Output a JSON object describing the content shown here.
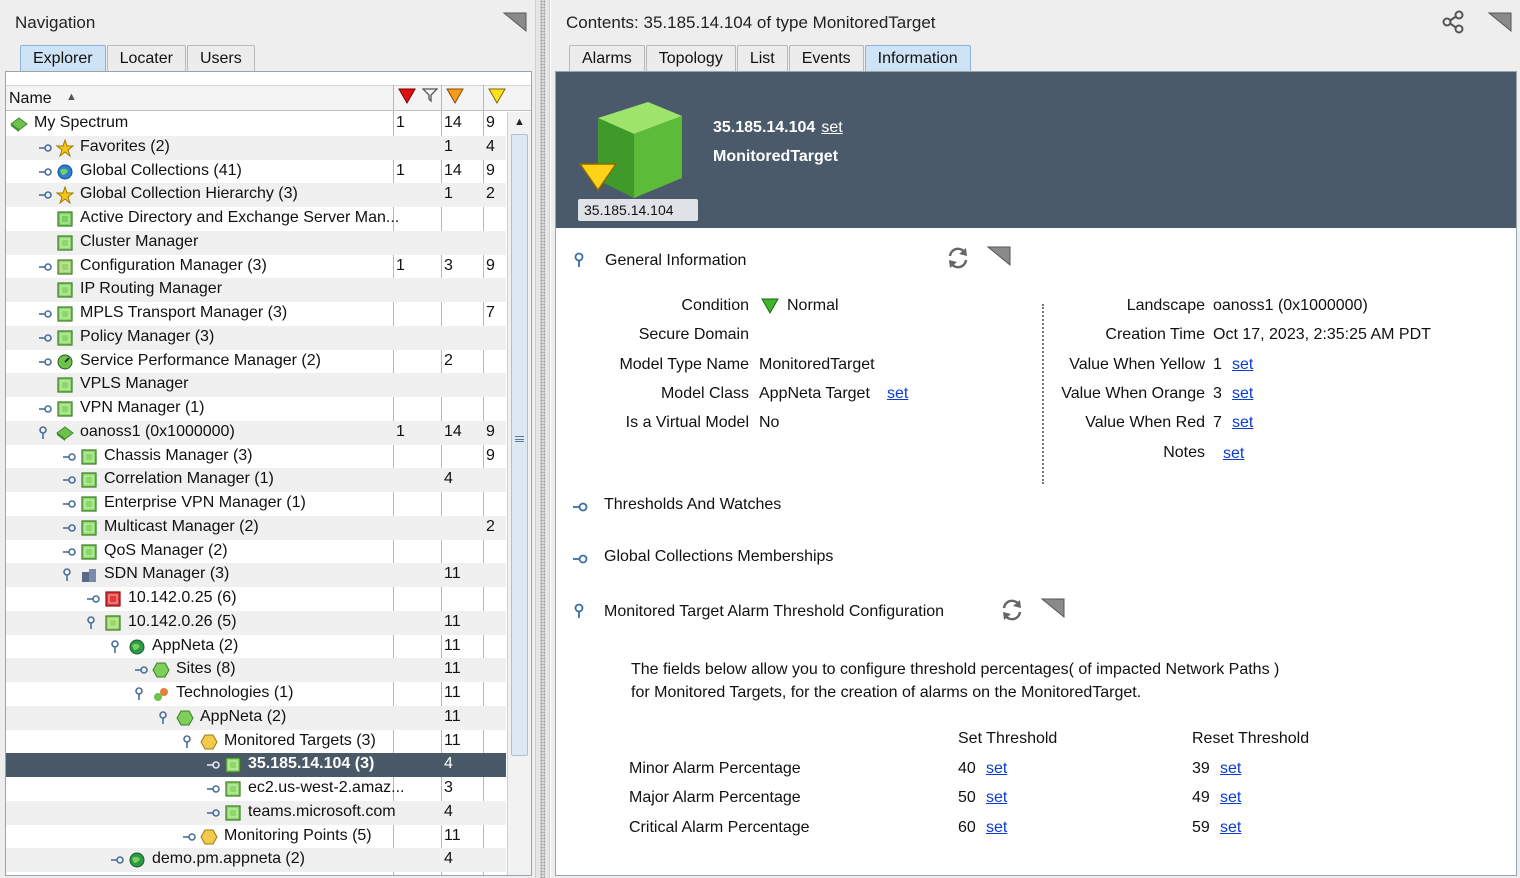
{
  "navigation": {
    "title": "Navigation",
    "tabs": [
      "Explorer",
      "Locater",
      "Users"
    ],
    "active_tab": "Explorer",
    "column_header": "Name",
    "rows": [
      {
        "name": "My Spectrum",
        "c1": "1",
        "c2": "14",
        "c3": "9",
        "icon": "my-spectrum-icon"
      },
      {
        "name": "Favorites  (2)",
        "c1": "",
        "c2": "1",
        "c3": "4",
        "icon": "star-icon"
      },
      {
        "name": "Global Collections  (41)",
        "c1": "1",
        "c2": "14",
        "c3": "9",
        "icon": "globe-icon"
      },
      {
        "name": "Global Collection Hierarchy  (3)",
        "c1": "",
        "c2": "1",
        "c3": "2",
        "icon": "star-icon"
      },
      {
        "name": "Active Directory and Exchange Server Man...",
        "c1": "",
        "c2": "",
        "c3": "",
        "icon": "directory-icon"
      },
      {
        "name": "Cluster Manager",
        "c1": "",
        "c2": "",
        "c3": "",
        "icon": "manager-icon"
      },
      {
        "name": "Configuration Manager  (3)",
        "c1": "1",
        "c2": "3",
        "c3": "9",
        "icon": "config-icon"
      },
      {
        "name": "IP Routing Manager",
        "c1": "",
        "c2": "",
        "c3": "",
        "icon": "manager-icon"
      },
      {
        "name": "MPLS Transport Manager  (3)",
        "c1": "",
        "c2": "",
        "c3": "7",
        "icon": "manager-icon"
      },
      {
        "name": "Policy Manager  (3)",
        "c1": "",
        "c2": "",
        "c3": "",
        "icon": "manager-icon"
      },
      {
        "name": "Service Performance Manager  (2)",
        "c1": "",
        "c2": "2",
        "c3": "",
        "icon": "gauge-icon"
      },
      {
        "name": "VPLS Manager",
        "c1": "",
        "c2": "",
        "c3": "",
        "icon": "manager-icon"
      },
      {
        "name": "VPN Manager  (1)",
        "c1": "",
        "c2": "",
        "c3": "",
        "icon": "manager-icon"
      },
      {
        "name": "oanoss1 (0x1000000)",
        "c1": "1",
        "c2": "14",
        "c3": "9",
        "icon": "landscape-icon"
      },
      {
        "name": "Chassis Manager  (3)",
        "c1": "",
        "c2": "",
        "c3": "9",
        "icon": "manager-icon"
      },
      {
        "name": "Correlation Manager  (1)",
        "c1": "",
        "c2": "4",
        "c3": "",
        "icon": "manager-icon"
      },
      {
        "name": "Enterprise VPN Manager  (1)",
        "c1": "",
        "c2": "",
        "c3": "",
        "icon": "manager-icon"
      },
      {
        "name": "Multicast Manager  (2)",
        "c1": "",
        "c2": "",
        "c3": "2",
        "icon": "manager-icon"
      },
      {
        "name": "QoS Manager  (2)",
        "c1": "",
        "c2": "",
        "c3": "",
        "icon": "manager-icon"
      },
      {
        "name": "SDN Manager  (3)",
        "c1": "",
        "c2": "11",
        "c3": "",
        "icon": "sdn-icon"
      },
      {
        "name": "10.142.0.25  (6)",
        "c1": "",
        "c2": "",
        "c3": "",
        "icon": "device-red-icon"
      },
      {
        "name": "10.142.0.26  (5)",
        "c1": "",
        "c2": "11",
        "c3": "",
        "icon": "device-green-icon"
      },
      {
        "name": "AppNeta  (2)",
        "c1": "",
        "c2": "11",
        "c3": "",
        "icon": "appneta-globe-icon"
      },
      {
        "name": "Sites  (8)",
        "c1": "",
        "c2": "11",
        "c3": "",
        "icon": "hexagon-green-icon"
      },
      {
        "name": "Technologies  (1)",
        "c1": "",
        "c2": "11",
        "c3": "",
        "icon": "technologies-icon"
      },
      {
        "name": "AppNeta  (2)",
        "c1": "",
        "c2": "11",
        "c3": "",
        "icon": "hexagon-green-icon"
      },
      {
        "name": "Monitored Targets  (3)",
        "c1": "",
        "c2": "11",
        "c3": "",
        "icon": "hexagon-yellow-icon"
      },
      {
        "name": "35.185.14.104  (3)",
        "c1": "",
        "c2": "4",
        "c3": "",
        "icon": "target-icon"
      },
      {
        "name": "ec2.us-west-2.amaz...",
        "c1": "",
        "c2": "3",
        "c3": "",
        "icon": "target-icon"
      },
      {
        "name": "teams.microsoft.com",
        "c1": "",
        "c2": "4",
        "c3": "",
        "icon": "target-icon"
      },
      {
        "name": "Monitoring Points  (5)",
        "c1": "",
        "c2": "11",
        "c3": "",
        "icon": "hexagon-yellow-icon"
      },
      {
        "name": "demo.pm.appneta  (2)",
        "c1": "",
        "c2": "4",
        "c3": "",
        "icon": "appneta-globe-icon"
      }
    ]
  },
  "contents": {
    "title": "Contents: 35.185.14.104 of type MonitoredTarget",
    "tabs": [
      "Alarms",
      "Topology",
      "List",
      "Events",
      "Information"
    ],
    "active_tab": "Information",
    "banner": {
      "name": "35.185.14.104",
      "set": "set",
      "type": "MonitoredTarget",
      "cube_label": "35.185.14.104"
    },
    "general": {
      "header": "General Information",
      "left": [
        {
          "label": "Condition",
          "value": "Normal"
        },
        {
          "label": "Secure Domain",
          "value": ""
        },
        {
          "label": "Model Type Name",
          "value": "MonitoredTarget"
        },
        {
          "label": "Model Class",
          "value": "AppNeta Target",
          "set": "set"
        },
        {
          "label": "Is a Virtual Model",
          "value": "No"
        }
      ],
      "right": [
        {
          "label": "Landscape",
          "value": "oanoss1 (0x1000000)"
        },
        {
          "label": "Creation Time",
          "value": "Oct 17, 2023, 2:35:25 AM PDT"
        },
        {
          "label": "Value When Yellow",
          "value": "1",
          "set": "set"
        },
        {
          "label": "Value When Orange",
          "value": "3",
          "set": "set"
        },
        {
          "label": "Value When Red",
          "value": "7",
          "set": "set"
        },
        {
          "label": "Notes",
          "value": "",
          "set": "set"
        }
      ]
    },
    "thresholds_header": "Thresholds And Watches",
    "gc_header": "Global Collections Memberships",
    "alarm_config": {
      "header": "Monitored Target Alarm Threshold Configuration",
      "desc1": "The fields below allow you to configure threshold percentages( of impacted Network Paths )",
      "desc2": "for Monitored Targets, for the creation of alarms on the MonitoredTarget.",
      "col_set": "Set Threshold",
      "col_reset": "Reset Threshold",
      "rows": [
        {
          "label": "Minor Alarm Percentage",
          "set": "40",
          "reset": "39"
        },
        {
          "label": "Major Alarm Percentage",
          "set": "50",
          "reset": "49"
        },
        {
          "label": "Critical Alarm Percentage",
          "set": "60",
          "reset": "59"
        }
      ],
      "set_link": "set"
    }
  },
  "colors": {
    "selected_row": "#495968",
    "banner": "#4a5a6a",
    "link": "#0a3ccf",
    "tab_active": "#cfe3f6"
  }
}
